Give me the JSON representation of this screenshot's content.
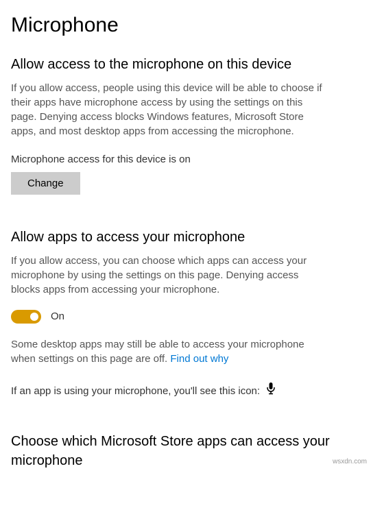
{
  "page": {
    "title": "Microphone"
  },
  "device_access": {
    "heading": "Allow access to the microphone on this device",
    "description": "If you allow access, people using this device will be able to choose if their apps have microphone access by using the settings on this page. Denying access blocks Windows features, Microsoft Store apps, and most desktop apps from accessing the microphone.",
    "status": "Microphone access for this device is on",
    "change_button": "Change"
  },
  "app_access": {
    "heading": "Allow apps to access your microphone",
    "description": "If you allow access, you can choose which apps can access your microphone by using the settings on this page. Denying access blocks apps from accessing your microphone.",
    "toggle_state": "On",
    "desktop_note_prefix": "Some desktop apps may still be able to access your microphone when settings on this page are off. ",
    "find_out_link": "Find out why",
    "icon_note": "If an app is using your microphone, you'll see this icon:"
  },
  "choose_apps": {
    "heading": "Choose which Microsoft Store apps can access your microphone"
  },
  "watermark": "wsxdn.com"
}
